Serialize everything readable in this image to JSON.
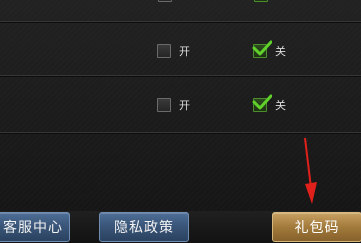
{
  "settings": {
    "rows": [
      {
        "left_option": {
          "label": "开",
          "checked": false
        },
        "right_option": {
          "label": "关",
          "checked": true
        }
      },
      {
        "left_option": {
          "label": "开",
          "checked": false
        },
        "right_option": {
          "label": "关",
          "checked": true
        }
      }
    ]
  },
  "bottom_bar": {
    "customer_service_label": "客服中心",
    "privacy_policy_label": "隐私政策",
    "gift_code_label": "礼包码"
  },
  "colors": {
    "check_green": "#5fd12a",
    "arrow_red": "#e0201b"
  }
}
